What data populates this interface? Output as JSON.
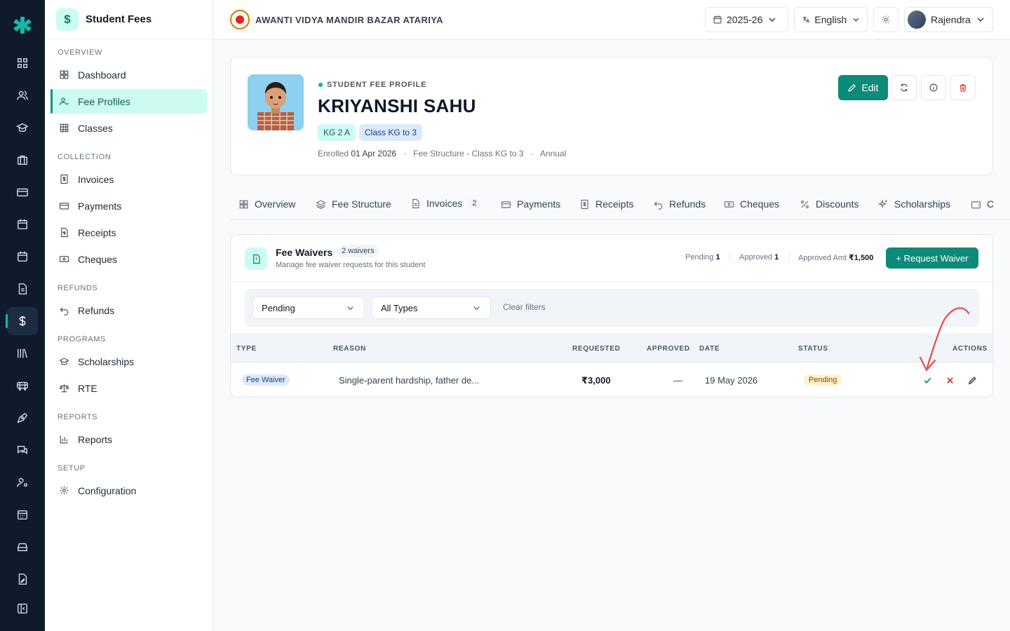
{
  "sidebar": {
    "title": "Student Fees",
    "badge": "$",
    "sections": {
      "overview": "OVERVIEW",
      "collection": "COLLECTION",
      "refunds": "REFUNDS",
      "programs": "PROGRAMS",
      "reports": "REPORTS",
      "setup": "SETUP"
    },
    "items": {
      "dashboard": "Dashboard",
      "fee_profiles": "Fee Profiles",
      "classes": "Classes",
      "invoices": "Invoices",
      "payments": "Payments",
      "receipts": "Receipts",
      "cheques": "Cheques",
      "refunds": "Refunds",
      "scholarships": "Scholarships",
      "rte": "RTE",
      "reports": "Reports",
      "configuration": "Configuration"
    },
    "active_item": "Fee Profiles"
  },
  "topbar": {
    "school_name": "AWANTI VIDYA MANDIR BAZAR ATARIYA",
    "academic_year": "2025-26",
    "language": "English",
    "user_name": "Rajendra"
  },
  "profile": {
    "eyebrow": "STUDENT FEE PROFILE",
    "name": "KRIYANSHI SAHU",
    "tag_section": "KG 2 A",
    "tag_class": "Class KG to 3",
    "enrolled_label": "Enrolled",
    "enrolled_date": "01 Apr 2026",
    "separator": "·",
    "fee_structure": "Fee Structure - Class KG to 3",
    "frequency": "Annual",
    "edit_label": "Edit"
  },
  "tabs": [
    {
      "label": "Overview"
    },
    {
      "label": "Fee Structure"
    },
    {
      "label": "Invoices",
      "count": "2"
    },
    {
      "label": "Payments"
    },
    {
      "label": "Receipts"
    },
    {
      "label": "Refunds"
    },
    {
      "label": "Cheques"
    },
    {
      "label": "Discounts"
    },
    {
      "label": "Scholarships"
    },
    {
      "label": "C"
    }
  ],
  "waivers": {
    "title": "Fee Waivers",
    "count_label": "2 waivers",
    "subtitle": "Manage fee waiver requests for this student",
    "stats": {
      "pending_label": "Pending",
      "pending_value": "1",
      "approved_label": "Approved",
      "approved_value": "1",
      "approved_amt_label": "Approved Amt",
      "approved_amt_value": "₹1,500"
    },
    "request_button": "+ Request Waiver",
    "filters": {
      "status": "Pending",
      "type": "All Types",
      "clear": "Clear filters"
    },
    "columns": {
      "type": "TYPE",
      "reason": "REASON",
      "requested": "REQUESTED",
      "approved": "APPROVED",
      "date": "DATE",
      "status": "STATUS",
      "actions": "ACTIONS"
    },
    "rows": [
      {
        "type": "Fee Waiver",
        "reason": "Single-parent hardship, father de...",
        "requested": "₹3,000",
        "approved": "—",
        "date": "19 May 2026",
        "status": "Pending"
      }
    ]
  },
  "colors": {
    "accent": "#0d8a78",
    "rail": "#0f1b2d",
    "annotation_arrow": "#e5484d"
  },
  "icons": {
    "rail": [
      "apps-icon",
      "users-icon",
      "graduation-icon",
      "briefcase-icon",
      "card-icon",
      "calendar-icon",
      "calendar-alt-icon",
      "document-icon",
      "dollar-icon",
      "library-icon",
      "bus-icon",
      "pen-icon",
      "chat-icon",
      "user-settings-icon",
      "calendar-grid-icon",
      "drive-icon",
      "file-edit-icon",
      "collapse-icon"
    ]
  }
}
